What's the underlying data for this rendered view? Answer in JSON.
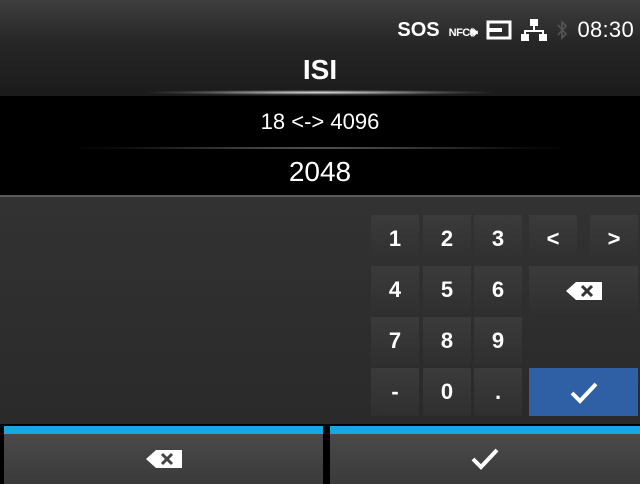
{
  "status_bar": {
    "sos": "SOS",
    "nfc": "NFC",
    "clock": "08:30",
    "icons": [
      "nfc-icon",
      "memory-card-icon",
      "network-icon",
      "bluetooth-icon"
    ]
  },
  "title": "ISI",
  "range": "18 <-> 4096",
  "value": "2048",
  "keypad": {
    "digits": [
      "1",
      "2",
      "3",
      "4",
      "5",
      "6",
      "7",
      "8",
      "9",
      "-",
      "0",
      "."
    ],
    "left": "<",
    "right": ">",
    "backspace_icon": "backspace-icon",
    "enter_icon": "check-icon"
  },
  "softkeys": {
    "left_icon": "backspace-icon",
    "right_icon": "check-icon"
  },
  "colors": {
    "accent_bar": "#1aa6e0",
    "enter_key": "#2f5fa5"
  }
}
